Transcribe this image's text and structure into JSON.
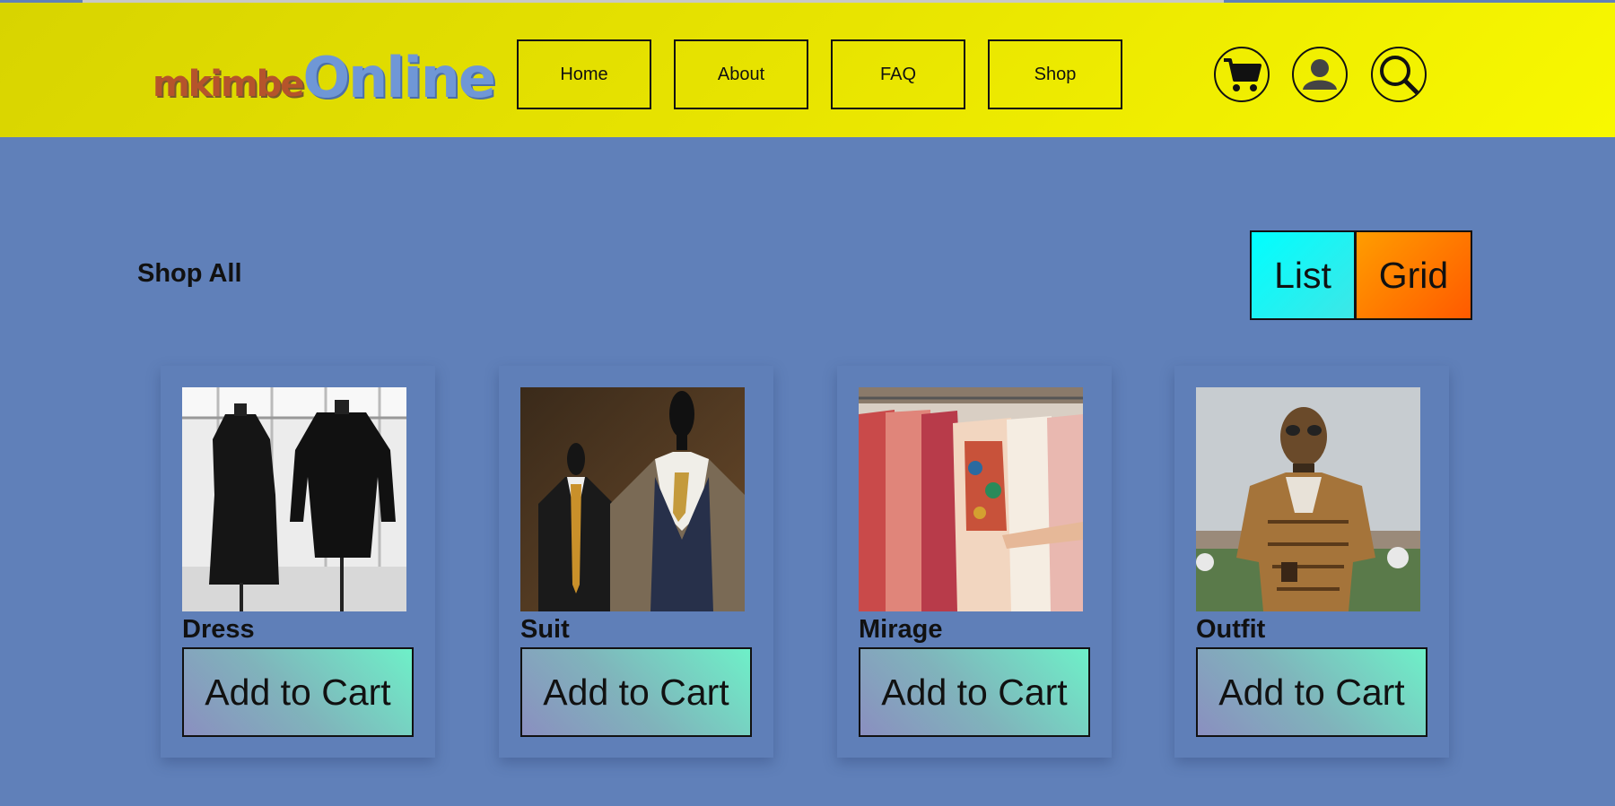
{
  "logo": {
    "part1": "mkimbe",
    "part2": "Online"
  },
  "nav": {
    "items": [
      {
        "label": "Home"
      },
      {
        "label": "About"
      },
      {
        "label": "FAQ"
      },
      {
        "label": "Shop"
      }
    ]
  },
  "header_icons": [
    "cart-icon",
    "user-icon",
    "search-icon"
  ],
  "main": {
    "title": "Shop All",
    "view_toggle": {
      "list_label": "List",
      "grid_label": "Grid"
    }
  },
  "products": [
    {
      "name": "Dress",
      "button": "Add to Cart"
    },
    {
      "name": "Suit",
      "button": "Add to Cart"
    },
    {
      "name": "Mirage",
      "button": "Add to Cart"
    },
    {
      "name": "Outfit",
      "button": "Add to Cart"
    }
  ],
  "colors": {
    "background": "#6080b9",
    "header": "#e8e400",
    "list_button": "#00ffff",
    "grid_button": "#ff7a00",
    "cart_button_start": "#8a8fc0",
    "cart_button_end": "#6ef0c8"
  }
}
